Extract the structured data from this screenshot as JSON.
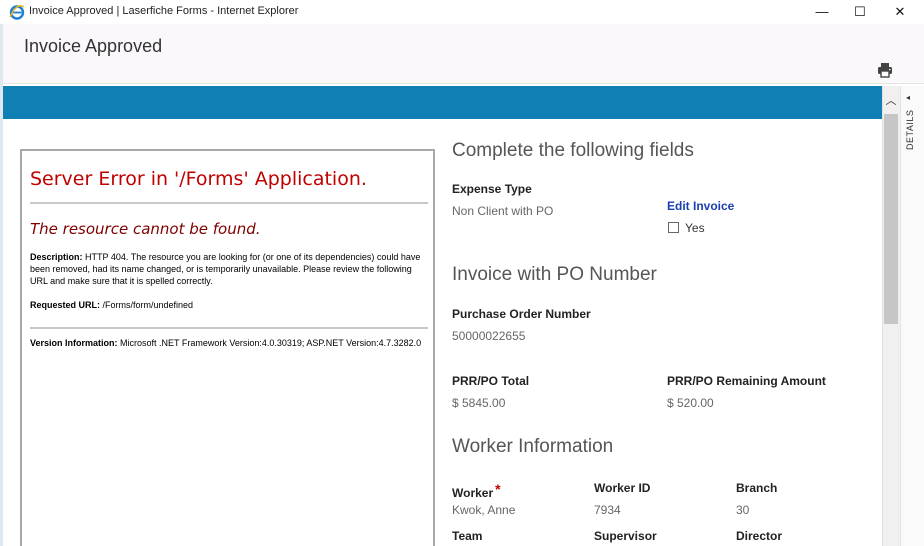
{
  "window": {
    "title": "Invoice Approved | Laserfiche Forms - Internet Explorer",
    "min_glyph": "—",
    "max_glyph": "☐",
    "close_glyph": "✕"
  },
  "header": {
    "title": "Invoice Approved",
    "print_icon": "print-icon"
  },
  "sidebar": {
    "details_label": "DETAILS",
    "collapse_arrow": "◂"
  },
  "scrollbar": {
    "up_arrow": "︿"
  },
  "error_page": {
    "heading": "Server Error in '/Forms' Application.",
    "subheading": "The resource cannot be found.",
    "description_label": "Description:",
    "description_text": " HTTP 404. The resource you are looking for (or one of its dependencies) could have been removed, had its name changed, or is temporarily unavailable.  Please review the following URL and make sure that it is spelled correctly.",
    "requested_url_label": "Requested URL:",
    "requested_url_value": " /Forms/form/undefined",
    "version_label": "Version Information:",
    "version_text": " Microsoft .NET Framework Version:4.0.30319; ASP.NET Version:4.7.3282.0"
  },
  "form": {
    "section1_title": "Complete the following fields",
    "expense_type_label": "Expense Type",
    "expense_type_value": "Non Client with PO",
    "edit_invoice_label": "Edit Invoice",
    "edit_invoice_option": "Yes",
    "edit_invoice_checked": false,
    "section2_title": "Invoice with PO Number",
    "po_number_label": "Purchase Order Number",
    "po_number_value": "50000022655",
    "prr_total_label": "PRR/PO Total",
    "prr_total_value": "$ 5845.00",
    "prr_remaining_label": "PRR/PO Remaining Amount",
    "prr_remaining_value": "$ 520.00",
    "section3_title": "Worker Information",
    "worker_label": "Worker",
    "worker_required": "*",
    "worker_value": "Kwok, Anne",
    "worker_id_label": "Worker ID",
    "worker_id_value": "7934",
    "branch_label": "Branch",
    "branch_value": "30",
    "team_label": "Team",
    "supervisor_label": "Supervisor",
    "director_label": "Director"
  },
  "colors": {
    "accent_band": "#0f7fb4",
    "error_heading": "#c00000",
    "error_subheading": "#800000",
    "link": "#1a3fb0"
  }
}
